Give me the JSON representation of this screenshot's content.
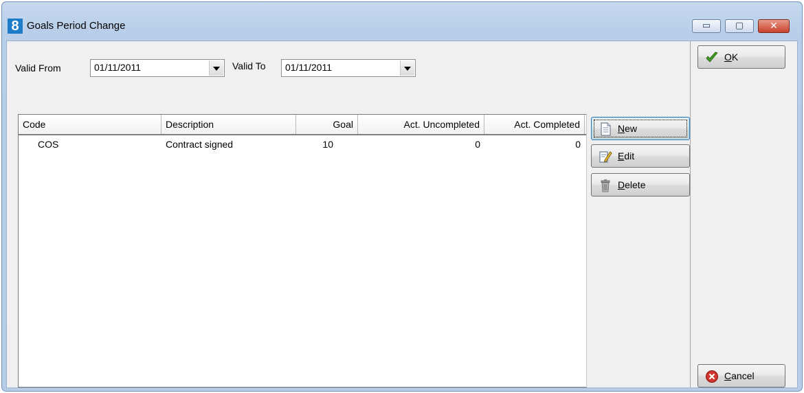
{
  "window": {
    "title": "Goals Period Change",
    "app_icon_text": "8",
    "controls": {
      "minimize": "▭",
      "maximize": "▢",
      "close": "✕"
    }
  },
  "filters": {
    "valid_from_label": "Valid From",
    "valid_from_value": "01/11/2011",
    "valid_to_label": "Valid To",
    "valid_to_value": "01/11/2011"
  },
  "grid": {
    "columns": [
      "Code",
      "Description",
      "Goal",
      "Act. Uncompleted",
      "Act. Completed"
    ],
    "rows": [
      {
        "code": "COS",
        "description": "Contract signed",
        "goal": "10",
        "act_uncompleted": "0",
        "act_completed": "0"
      }
    ]
  },
  "actions": {
    "new_first": "N",
    "new_rest": "ew",
    "edit_first": "E",
    "edit_rest": "dit",
    "delete_first": "D",
    "delete_rest": "elete"
  },
  "dialog": {
    "ok_first": "O",
    "ok_rest": "K",
    "cancel_first": "C",
    "cancel_rest": "ancel"
  },
  "colors": {
    "accent": "#1c7cc7",
    "ok_check": "#3f9b23",
    "cancel_red": "#d0342c"
  }
}
